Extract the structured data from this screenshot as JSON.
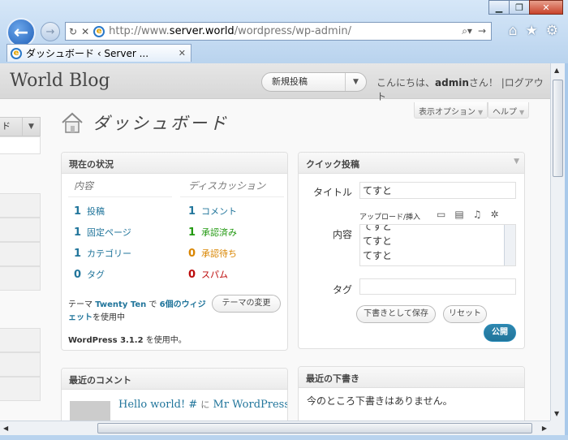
{
  "browser": {
    "url_prefix": "http://www.",
    "url_domain": "server.world",
    "url_path": "/wordpress/wp-admin/",
    "tab_title": "ダッシュボード ‹ Server ..."
  },
  "header": {
    "blog_title": "World Blog",
    "favorite_action": "新規投稿",
    "greeting_prefix": "こんにちは、",
    "username": "admin",
    "greeting_suffix": "さん！",
    "separator": "|",
    "logout": "ログアウト"
  },
  "sidebar": {
    "collapse_label": "ド"
  },
  "screen_meta": {
    "options": "表示オプション",
    "help": "ヘルプ"
  },
  "page_title": "ダッシュボード",
  "right_now": {
    "title": "現在の状況",
    "content_header": "内容",
    "discussion_header": "ディスカッション",
    "content": [
      {
        "count": "1",
        "label": "投稿"
      },
      {
        "count": "1",
        "label": "固定ページ"
      },
      {
        "count": "1",
        "label": "カテゴリー"
      },
      {
        "count": "0",
        "label": "タグ"
      }
    ],
    "discussion": [
      {
        "count": "1",
        "label": "コメント"
      },
      {
        "count": "1",
        "label": "承認済み"
      },
      {
        "count": "0",
        "label": "承認待ち"
      },
      {
        "count": "0",
        "label": "スパム"
      }
    ],
    "theme_prefix": "テーマ",
    "theme_name": "Twenty Ten",
    "theme_mid": "で",
    "widgets_link": "6個のウィジェット",
    "theme_suffix": "を使用中",
    "change_theme": "テーマの変更",
    "version_text": "WordPress 3.1.2",
    "version_suffix": "を使用中。"
  },
  "quick_press": {
    "title": "クイック投稿",
    "title_label": "タイトル",
    "title_value": "てすと",
    "upload_label": "アップロード/挿入",
    "content_label": "内容",
    "content_lines": [
      "てすと",
      "てすと",
      "てすと"
    ],
    "tags_label": "タグ",
    "tags_value": "",
    "save_draft": "下書きとして保存",
    "reset": "リセット",
    "publish": "公開"
  },
  "recent_comments": {
    "title": "最近のコメント",
    "post_link": "Hello world!",
    "hash": "#",
    "on": "に",
    "author": "Mr WordPress"
  },
  "recent_drafts": {
    "title": "最近の下書き",
    "empty": "今のところ下書きはありません。"
  }
}
